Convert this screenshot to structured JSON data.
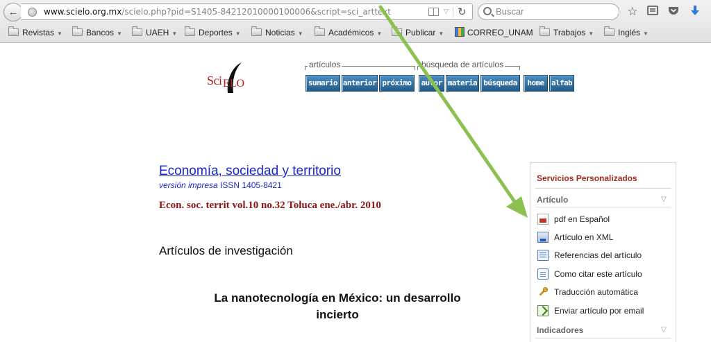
{
  "browser": {
    "url_host": "www.scielo.org.mx",
    "url_path": "/scielo.php?pid=S1405-84212010000100006&script=sci_arttext",
    "search_placeholder": "Buscar",
    "bookmarks": [
      {
        "label": "Revistas",
        "type": "folder"
      },
      {
        "label": "Bancos",
        "type": "folder"
      },
      {
        "label": "UAEH",
        "type": "folder"
      },
      {
        "label": "Deportes",
        "type": "folder"
      },
      {
        "label": "Noticias",
        "type": "folder"
      },
      {
        "label": "Académicos",
        "type": "folder"
      },
      {
        "label": "Publicar",
        "type": "folder"
      },
      {
        "label": "CORREO_UNAM",
        "type": "link"
      },
      {
        "label": "Trabajos",
        "type": "folder"
      },
      {
        "label": "Inglés",
        "type": "folder"
      }
    ]
  },
  "scielo_nav": {
    "logo_sci": "Sci",
    "logo_elo": "ELO",
    "group_articulos": "artículos",
    "group_busqueda": "búsqueda de artículos",
    "buttons": {
      "sumario": "sumario",
      "anterior": "anterior",
      "proximo": "próximo",
      "autor": "autor",
      "materia": "materia",
      "busqueda": "búsqueda",
      "home": "home",
      "alfab": "alfab"
    }
  },
  "article": {
    "journal_title": "Economía, sociedad y territorio",
    "version_label": "versión impresa",
    "issn": "ISSN 1405-8421",
    "citation": "Econ. soc. territ vol.10 no.32 Toluca ene./abr. 2010",
    "section": "Artículos de investigación",
    "title_line1": "La nanotecnología en México: un desarrollo",
    "title_line2": "incierto"
  },
  "services": {
    "title": "Servicios Personalizados",
    "section_articulo": "Artículo",
    "items": [
      {
        "label": "pdf en Español",
        "icon": "pdf-icon"
      },
      {
        "label": "Artículo en XML",
        "icon": "xml-icon"
      },
      {
        "label": "Referencias del artículo",
        "icon": "references-icon"
      },
      {
        "label": "Como citar este artículo",
        "icon": "cite-icon"
      },
      {
        "label": "Traducción automática",
        "icon": "translate-icon"
      },
      {
        "label": "Enviar artículo por email",
        "icon": "email-icon"
      }
    ],
    "section_indicadores": "Indicadores"
  },
  "annotation": {
    "arrow_color": "#8cc152"
  }
}
